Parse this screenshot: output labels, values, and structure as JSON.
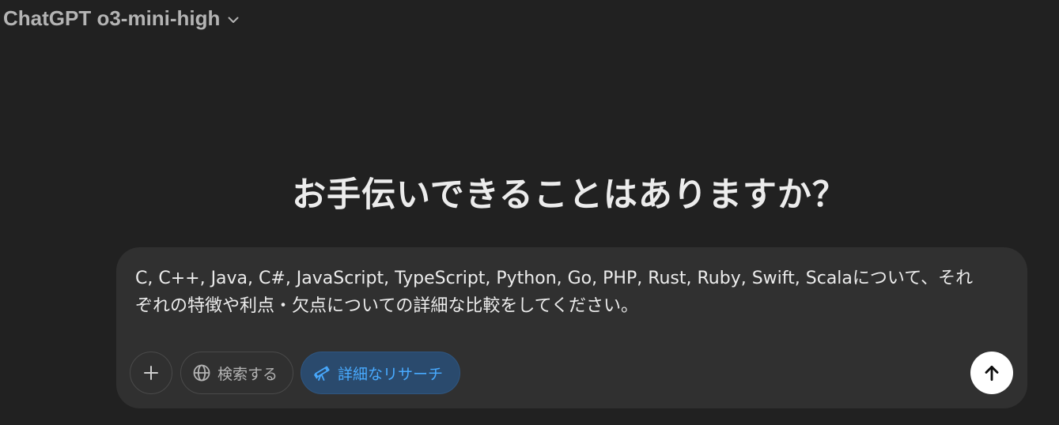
{
  "header": {
    "model_label": "ChatGPT o3-mini-high"
  },
  "main": {
    "heading": "お手伝いできることはありますか？"
  },
  "composer": {
    "prompt": "C, C++, Java, C#, JavaScript, TypeScript, Python, Go, PHP, Rust, Ruby, Swift, Scalaについて、それぞれの特徴や利点・欠点についての詳細な比較をしてください。",
    "buttons": {
      "search_label": "検索する",
      "research_label": "詳細なリサーチ"
    },
    "icons": {
      "plus": "plus-icon",
      "search": "globe-icon",
      "research": "telescope-icon",
      "send": "arrow-up-icon"
    }
  },
  "colors": {
    "background": "#212121",
    "composer": "#303030",
    "research_accent": "#48aaff",
    "research_bg": "#2a4a6d"
  }
}
